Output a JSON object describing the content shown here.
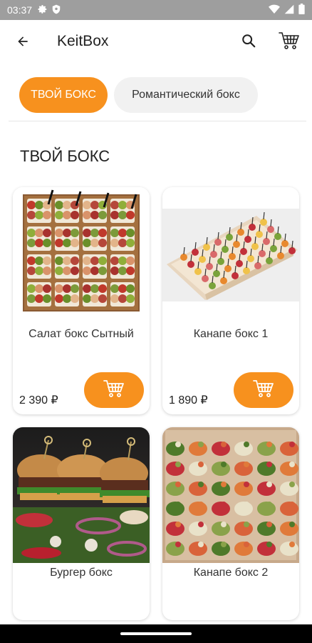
{
  "status_bar": {
    "time": "03:37",
    "left_icons": [
      "gear-icon",
      "shield-icon"
    ],
    "right_icons": [
      "wifi-icon",
      "signal-icon",
      "battery-icon"
    ]
  },
  "app_bar": {
    "title": "KeitBox",
    "icons": [
      "arrow-back-icon",
      "search-icon",
      "cart-icon"
    ]
  },
  "tabs": [
    {
      "label": "ТВОЙ БОКС",
      "active": true
    },
    {
      "label": "Романтический бокс",
      "active": false
    }
  ],
  "section": {
    "title": "ТВОЙ БОКС"
  },
  "products": [
    {
      "name": "Салат бокс Сытный",
      "price": "2 390 ₽"
    },
    {
      "name": "Канапе бокс 1",
      "price": "1 890 ₽"
    },
    {
      "name": "Бургер бокс"
    },
    {
      "name": "Канапе бокс 2"
    }
  ],
  "colors": {
    "accent": "#f7911e",
    "status_bar": "#9e9e9e",
    "tab_inactive": "#f1f1f1"
  }
}
